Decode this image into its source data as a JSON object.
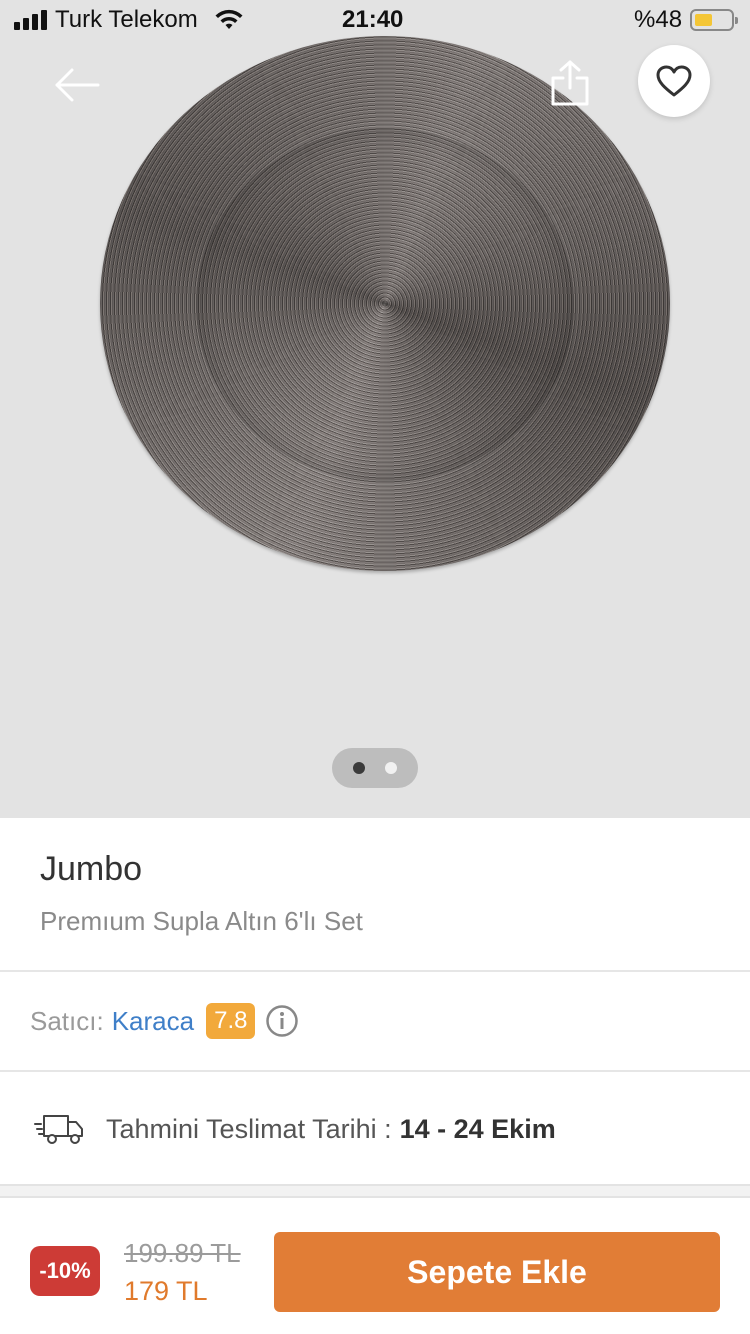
{
  "status_bar": {
    "carrier": "Turk Telekom",
    "time": "21:40",
    "battery_percent": "%48",
    "battery_level": 0.48,
    "battery_color": "#f4c636"
  },
  "header": {
    "back_icon": "arrow-left-icon",
    "share_icon": "share-icon",
    "favorite_icon": "heart-icon"
  },
  "gallery": {
    "image_count": 2,
    "active_index": 0
  },
  "product": {
    "brand": "Jumbo",
    "name": "Premıum Supla Altın 6'lı Set"
  },
  "seller": {
    "label": "Satıcı:",
    "name": "Karaca",
    "score": "7.8",
    "score_color": "#f2a93b",
    "link_color": "#3f7fc8"
  },
  "delivery": {
    "label": "Tahmini Teslimat Tarihi :",
    "date": "14 - 24 Ekim"
  },
  "purchase": {
    "discount": "-10%",
    "old_price": "199.89 TL",
    "new_price": "179 TL",
    "button_label": "Sepete Ekle",
    "accent": "#e17d36",
    "discount_color": "#cd3b36"
  }
}
